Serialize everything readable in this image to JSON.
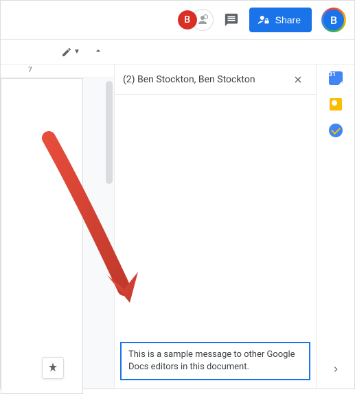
{
  "topbar": {
    "presence_initial": "B",
    "share_label": "Share",
    "profile_initial": "B"
  },
  "ruler": {
    "tick_label": "7"
  },
  "chat": {
    "title": "(2) Ben Stockton, Ben Stockton",
    "input_value": "This is a sample message to other Google Docs editors in this document."
  },
  "side_panel": {
    "calendar_day": "31"
  }
}
